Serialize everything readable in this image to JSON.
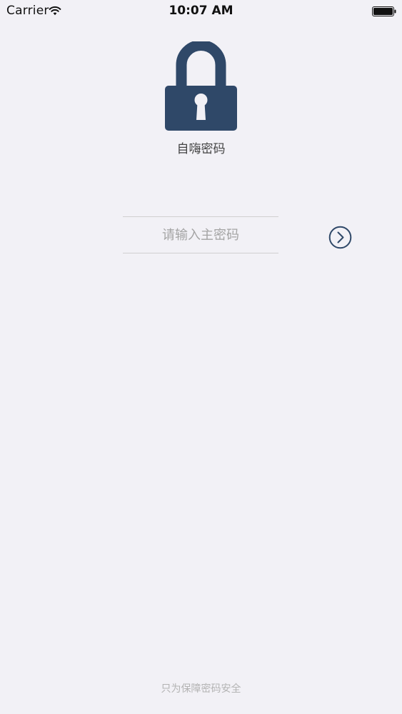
{
  "status_bar": {
    "carrier": "Carrier",
    "time": "10:07 AM",
    "wifi_icon": "wifi-icon",
    "battery_icon": "battery-icon"
  },
  "app": {
    "title": "自嗨密码",
    "logo_icon": "padlock-icon"
  },
  "login": {
    "password_placeholder": "请输入主密码",
    "password_value": "",
    "submit_icon": "chevron-right-circle-icon"
  },
  "footer": {
    "text": "只为保障密码安全"
  },
  "colors": {
    "background": "#f2f1f6",
    "accent": "#2f4868",
    "divider": "#d0d0d0",
    "placeholder": "#a4a4a4",
    "footer_text": "#b3b3b3"
  }
}
